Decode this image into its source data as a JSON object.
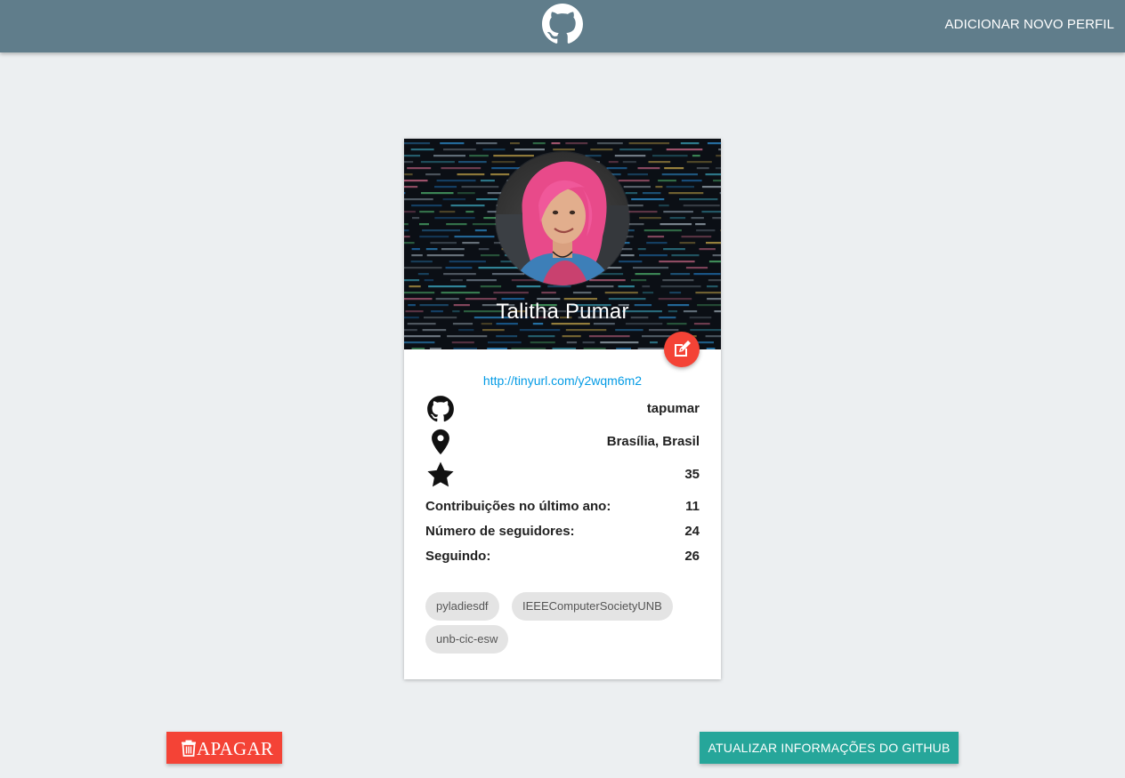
{
  "navbar": {
    "logo_icon": "github-icon",
    "add_profile_label": "ADICIONAR NOVO PERFIL"
  },
  "profile": {
    "name": "Talitha Pumar",
    "avatar_icon": "avatar-photo",
    "edit_icon": "edit-icon",
    "url": "http://tinyurl.com/y2wqm6m2",
    "username": "tapumar",
    "location": "Brasília, Brasil",
    "stars": "35",
    "stats": [
      {
        "label": "Contribuições no último ano:",
        "value": "11"
      },
      {
        "label": "Número de seguidores:",
        "value": "24"
      },
      {
        "label": "Seguindo:",
        "value": "26"
      }
    ],
    "organizations": [
      "pyladiesdf",
      "IEEEComputerSocietyUNB",
      "unb-cic-esw"
    ]
  },
  "actions": {
    "delete_label": "APAGAR",
    "delete_icon": "trash-icon",
    "update_label": "ATUALIZAR INFORMAÇÕES DO GITHUB"
  },
  "colors": {
    "navbar": "#607d8b",
    "background": "#eceff1",
    "danger": "#f44336",
    "teal": "#26a69a",
    "link": "#039be5"
  }
}
